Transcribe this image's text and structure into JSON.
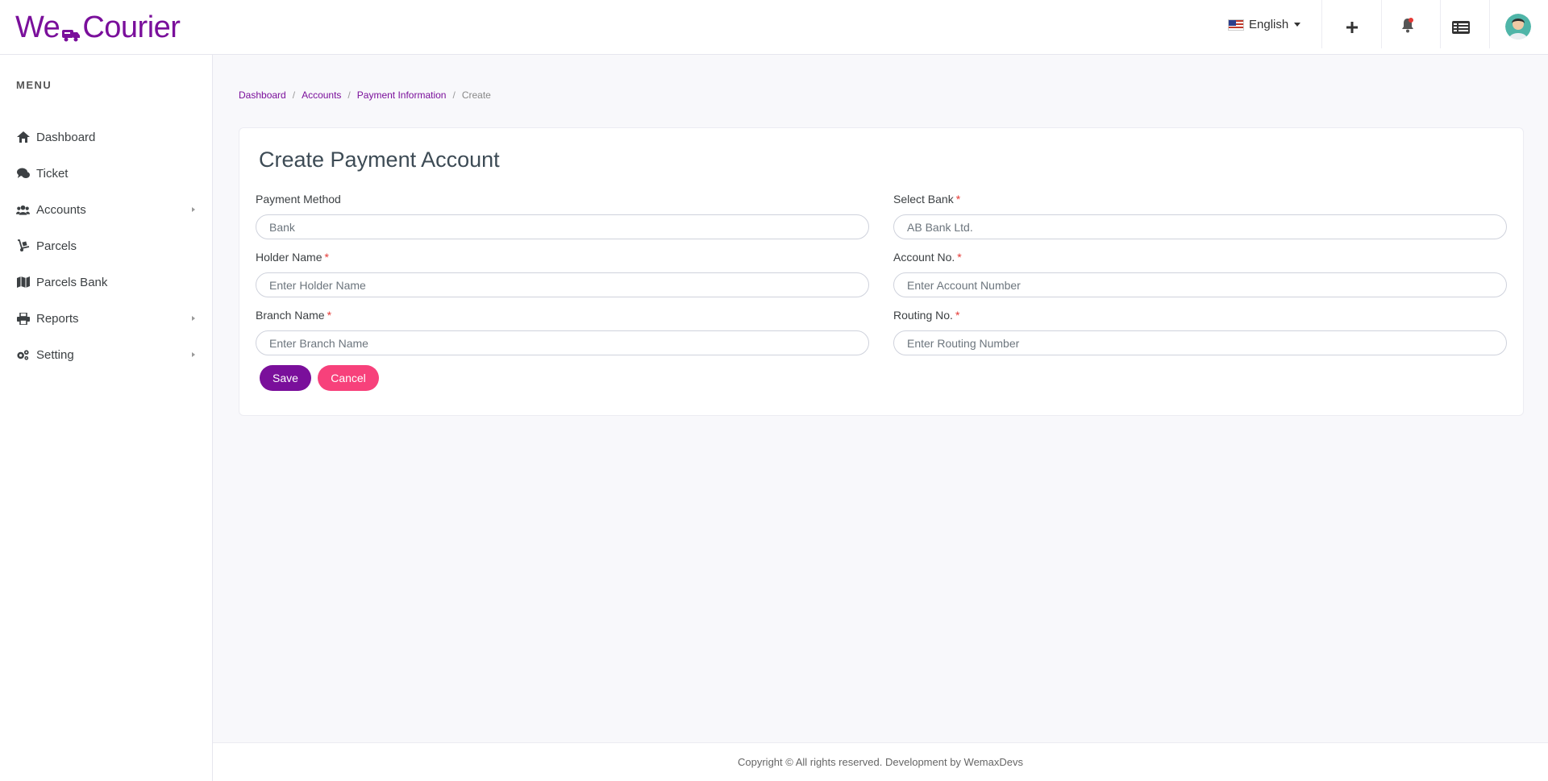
{
  "header": {
    "logo_text_left": "We",
    "logo_text_right": "Courier",
    "language": "English",
    "brand_color": "#7a0f9b",
    "icons": [
      "add-icon",
      "bell-icon",
      "list-icon",
      "avatar"
    ]
  },
  "sidebar": {
    "menu_title": "MENU",
    "items": [
      {
        "label": "Dashboard",
        "icon": "home-icon"
      },
      {
        "label": "Ticket",
        "icon": "chat-icon"
      },
      {
        "label": "Accounts",
        "icon": "users-icon",
        "has_submenu": true
      },
      {
        "label": "Parcels",
        "icon": "dolly-icon"
      },
      {
        "label": "Parcels Bank",
        "icon": "map-icon"
      },
      {
        "label": "Reports",
        "icon": "printer-icon",
        "has_submenu": true
      },
      {
        "label": "Setting",
        "icon": "gears-icon",
        "has_submenu": true
      }
    ]
  },
  "breadcrumb": {
    "items": [
      "Dashboard",
      "Accounts",
      "Payment Information"
    ],
    "current": "Create"
  },
  "form": {
    "title": "Create Payment Account",
    "payment_method": {
      "label": "Payment Method",
      "value": "Bank"
    },
    "select_bank": {
      "label": "Select Bank",
      "value": "AB Bank Ltd."
    },
    "holder_name": {
      "label": "Holder Name",
      "placeholder": "Enter Holder Name"
    },
    "account_no": {
      "label": "Account No.",
      "placeholder": "Enter Account Number"
    },
    "branch_name": {
      "label": "Branch Name",
      "placeholder": "Enter Branch Name"
    },
    "routing_no": {
      "label": "Routing No.",
      "placeholder": "Enter Routing Number"
    },
    "required_mark": "*",
    "save_label": "Save",
    "cancel_label": "Cancel",
    "save_color": "#7a0f9b",
    "cancel_color": "#f7417b"
  },
  "footer": {
    "text": "Copyright © All rights reserved. Development by WemaxDevs"
  }
}
